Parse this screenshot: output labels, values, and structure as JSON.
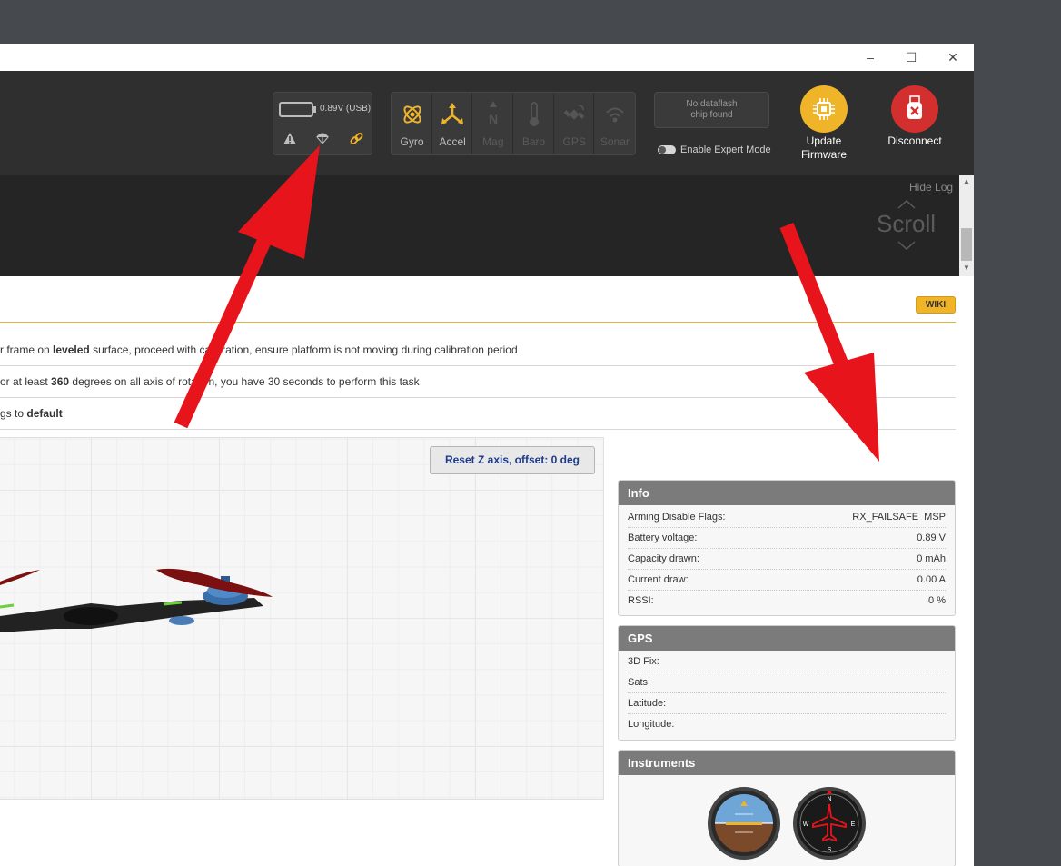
{
  "window": {
    "controls": {
      "minimize": "–",
      "maximize": "☐",
      "close": "✕"
    }
  },
  "status": {
    "battery_text": "0.89V (USB)",
    "icons": [
      "warning-icon",
      "failsafe-parachute-icon",
      "link-icon"
    ]
  },
  "sensors": [
    {
      "label": "Gyro",
      "icon": "gyro-icon",
      "active": true
    },
    {
      "label": "Accel",
      "icon": "accel-icon",
      "active": true
    },
    {
      "label": "Mag",
      "icon": "mag-icon",
      "active": false
    },
    {
      "label": "Baro",
      "icon": "baro-icon",
      "active": false
    },
    {
      "label": "GPS",
      "icon": "gps-icon",
      "active": false
    },
    {
      "label": "Sonar",
      "icon": "sonar-icon",
      "active": false
    }
  ],
  "dataflash": {
    "line1": "No dataflash",
    "line2": "chip found"
  },
  "expert_mode": {
    "label": "Enable Expert Mode",
    "enabled": false
  },
  "header_buttons": {
    "update_firmware": {
      "line1": "Update",
      "line2": "Firmware",
      "color": "#f0b429"
    },
    "disconnect": {
      "label": "Disconnect",
      "color": "#d32f2f"
    }
  },
  "log": {
    "hide_log": "Hide Log",
    "scroll": "Scroll"
  },
  "setup": {
    "wiki": "WIKI",
    "notes": [
      {
        "pre": "r frame on ",
        "bold": "leveled",
        "post": " surface, proceed with calibration, ensure platform is not moving during calibration period"
      },
      {
        "pre": "or at least ",
        "bold": "360",
        "post": " degrees on all axis of rotation, you have 30 seconds to perform this task"
      },
      {
        "pre": "gs to ",
        "bold": "default",
        "post": ""
      }
    ],
    "reset_button": "Reset Z axis, offset: 0 deg"
  },
  "info": {
    "title": "Info",
    "rows": [
      {
        "label": "Arming Disable Flags:",
        "value": "RX_FAILSAFE  MSP"
      },
      {
        "label": "Battery voltage:",
        "value": "0.89 V"
      },
      {
        "label": "Capacity drawn:",
        "value": "0 mAh"
      },
      {
        "label": "Current draw:",
        "value": "0.00 A"
      },
      {
        "label": "RSSI:",
        "value": "0 %"
      }
    ]
  },
  "gps": {
    "title": "GPS",
    "rows": [
      {
        "label": "3D Fix:",
        "value": ""
      },
      {
        "label": "Sats:",
        "value": ""
      },
      {
        "label": "Latitude:",
        "value": ""
      },
      {
        "label": "Longitude:",
        "value": ""
      }
    ]
  },
  "instruments": {
    "title": "Instruments",
    "items": [
      "attitude-indicator",
      "heading-indicator"
    ]
  },
  "colors": {
    "accent": "#f0b429",
    "arrow": "#e8141c",
    "header_bg": "#2f2f2f"
  }
}
